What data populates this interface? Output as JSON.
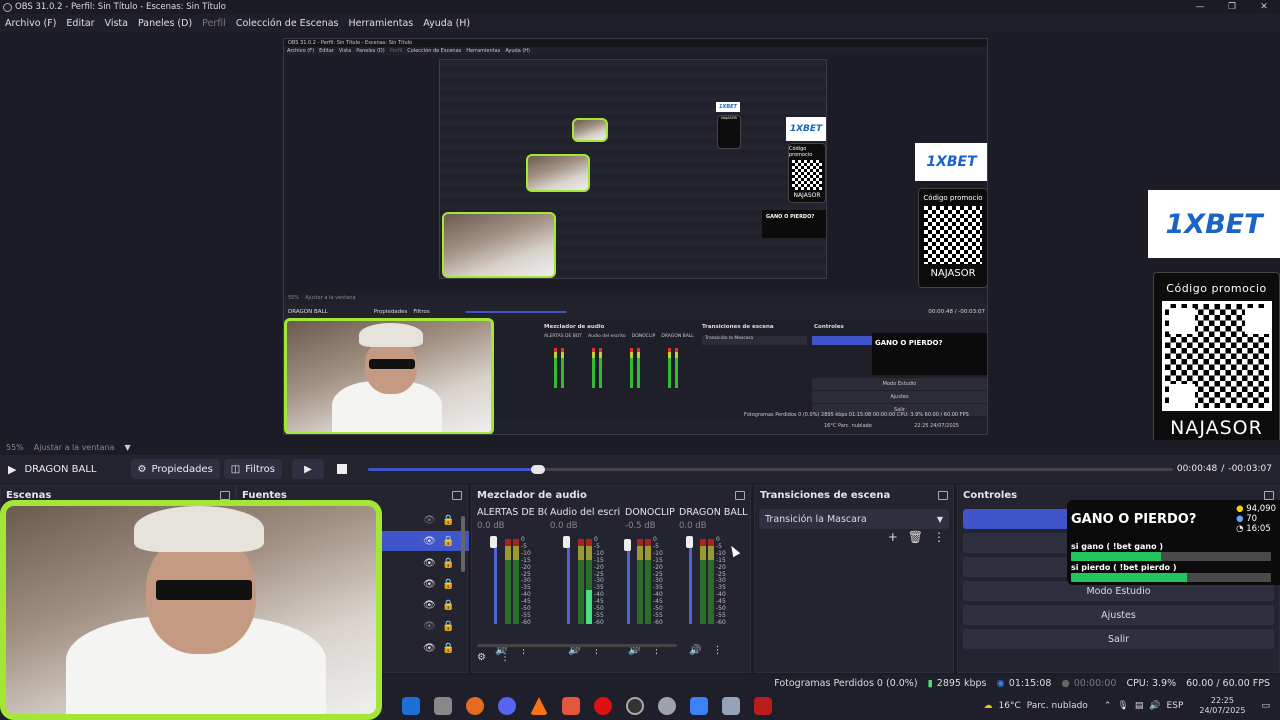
{
  "window": {
    "title": "OBS 31.0.2 - Perfil: Sin Título - Escenas: Sin Título",
    "min": "—",
    "max": "❐",
    "close": "✕"
  },
  "menu": [
    "Archivo (F)",
    "Editar",
    "Vista",
    "Paneles (D)",
    "Perfil",
    "Colección de Escenas",
    "Herramientas",
    "Ayuda (H)"
  ],
  "preview": {
    "nested_title": "OBS 31.0.2 - Perfil: Sin Título - Escenas: Sin Título",
    "nested_menu": [
      "Archivo (F)",
      "Editar",
      "Vista",
      "Paneles (D)",
      "Perfil",
      "Colección de Escenas",
      "Herramientas",
      "Ayuda (H)"
    ],
    "nested_zoom": "55%",
    "nested_fit": "Ajustar a la ventana",
    "nested_source": "DRAGON BALL",
    "nested_props": "Propiedades",
    "nested_filters": "Filtros",
    "nested_time": "00:00:48 / -00:03:07",
    "nested_scenes": "Escenas",
    "nested_sources": "Fuentes",
    "nested_mixer": "Mezclador de audio",
    "nested_transitions": "Transiciones de escena",
    "nested_controls": "Controles",
    "nested_transition": "Transición la Mascara",
    "nested_channels": [
      "ALERTAS DE BOT",
      "Audio del escrito",
      "DONOCLIP",
      "DRAGON BALL"
    ],
    "nested_status": "Fotogramas Perdidos 0 (0.0%)   2895 kbps   01:15:08   00:00:00   CPU: 3.9%   60.00 / 60.00 FPS",
    "nested_weather": "16°C Parc. nublado",
    "nested_clock": "22:25 24/07/2025",
    "nested_modes": [
      "Modo Estudio",
      "Ajustes",
      "Salir"
    ],
    "bet_logo": "1XBET",
    "promo_label": "Código promocio",
    "promo_code": "NAJASOR"
  },
  "zoom": {
    "percent": "55%",
    "fit": "Ajustar a la ventana"
  },
  "source_toolbar": {
    "source": "DRAGON BALL",
    "properties": "Propiedades",
    "filters": "Filtros",
    "time": "00:00:48",
    "separator": "/",
    "remaining": "-00:03:07",
    "progress": 0.21
  },
  "docks": {
    "scenes": "Escenas",
    "sources": "Fuentes",
    "mixer": "Mezclador de audio",
    "transitions": "Transiciones de escena",
    "controls": "Controles"
  },
  "mixer": {
    "channels": [
      {
        "name": "ALERTAS DE BOT",
        "db": "0.0 dB"
      },
      {
        "name": "Audio del escrito",
        "db": "0.0 dB"
      },
      {
        "name": "DONOCLIP",
        "db": "-0.5 dB"
      },
      {
        "name": "DRAGON BALL",
        "db": "0.0 dB"
      }
    ],
    "scale": [
      "0",
      "-5",
      "-10",
      "-15",
      "-20",
      "-25",
      "-30",
      "-35",
      "-40",
      "-45",
      "-50",
      "-55",
      "-60"
    ]
  },
  "transitions": {
    "selected": "Transición la Mascara"
  },
  "controls": {
    "studio": "Modo Estudio",
    "settings": "Ajustes",
    "exit": "Salir"
  },
  "poll": {
    "title": "GANO O PIERDO?",
    "coins": "94,090",
    "users": "70",
    "timer": "16:05",
    "option1": "si gano ( !bet gano )",
    "option2": "si pierdo ( !bet pierdo )",
    "option1_share": 0.45,
    "option2_share": 0.58
  },
  "status": {
    "dropped": "Fotogramas Perdidos 0 (0.0%)",
    "kbps": "2895 kbps",
    "stream_time": "01:15:08",
    "rec_time": "00:00:00",
    "cpu": "CPU: 3.9%",
    "fps": "60.00 / 60.00 FPS"
  },
  "taskbar": {
    "weather": "16°C",
    "weather_desc": "Parc. nublado",
    "lang": "ESP",
    "time": "22:25",
    "date": "24/07/2025"
  },
  "colors": {
    "accent": "#3f55c9",
    "cam_border": "#a3e635",
    "bet_blue": "#1a64c8",
    "poll_green": "#22c55e"
  }
}
